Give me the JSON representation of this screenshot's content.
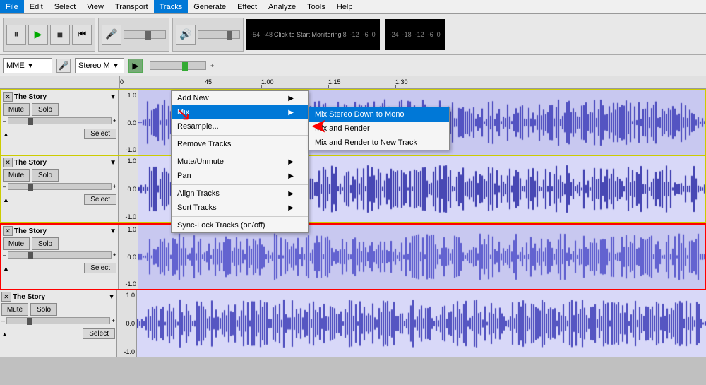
{
  "menubar": {
    "items": [
      "File",
      "Edit",
      "Select",
      "View",
      "Transport",
      "Tracks",
      "Generate",
      "Effect",
      "Analyze",
      "Tools",
      "Help"
    ]
  },
  "toolbar": {
    "pause_label": "⏸",
    "play_label": "▶",
    "stop_label": "■",
    "skip_label": "⏮"
  },
  "toolbar2": {
    "device": "MME",
    "stereo": "Stereo M"
  },
  "ruler": {
    "marks": [
      "0",
      "45",
      "1:00",
      "1:15",
      "1:30"
    ]
  },
  "tracks_menu": {
    "items": [
      {
        "label": "Add New",
        "has_submenu": true
      },
      {
        "label": "Mix",
        "has_submenu": true
      },
      {
        "label": "Resample...",
        "has_submenu": false
      },
      {
        "label": "Remove Tracks",
        "has_submenu": false
      },
      {
        "label": "Mute/Unmute",
        "has_submenu": true
      },
      {
        "label": "Pan",
        "has_submenu": true
      },
      {
        "label": "Align Tracks",
        "has_submenu": true
      },
      {
        "label": "Sort Tracks",
        "has_submenu": true
      },
      {
        "label": "Sync-Lock Tracks (on/off)",
        "has_submenu": false
      }
    ]
  },
  "mix_submenu": {
    "items": [
      {
        "label": "Mix Stereo Down to Mono",
        "highlighted": true
      },
      {
        "label": "Mix and Render"
      },
      {
        "label": "Mix and Render to New Track"
      }
    ]
  },
  "tracks": [
    {
      "name": "The Story",
      "selected": true,
      "mute": "Mute",
      "solo": "Solo",
      "select": "Select"
    },
    {
      "name": "The Story",
      "selected": true,
      "mute": "Mute",
      "solo": "Solo",
      "select": "Select"
    },
    {
      "name": "The Story",
      "selected": true,
      "mute": "Mute",
      "solo": "Solo",
      "select": "Select"
    },
    {
      "name": "The Story",
      "selected": true,
      "mute": "Mute",
      "solo": "Solo",
      "select": "Select"
    }
  ]
}
